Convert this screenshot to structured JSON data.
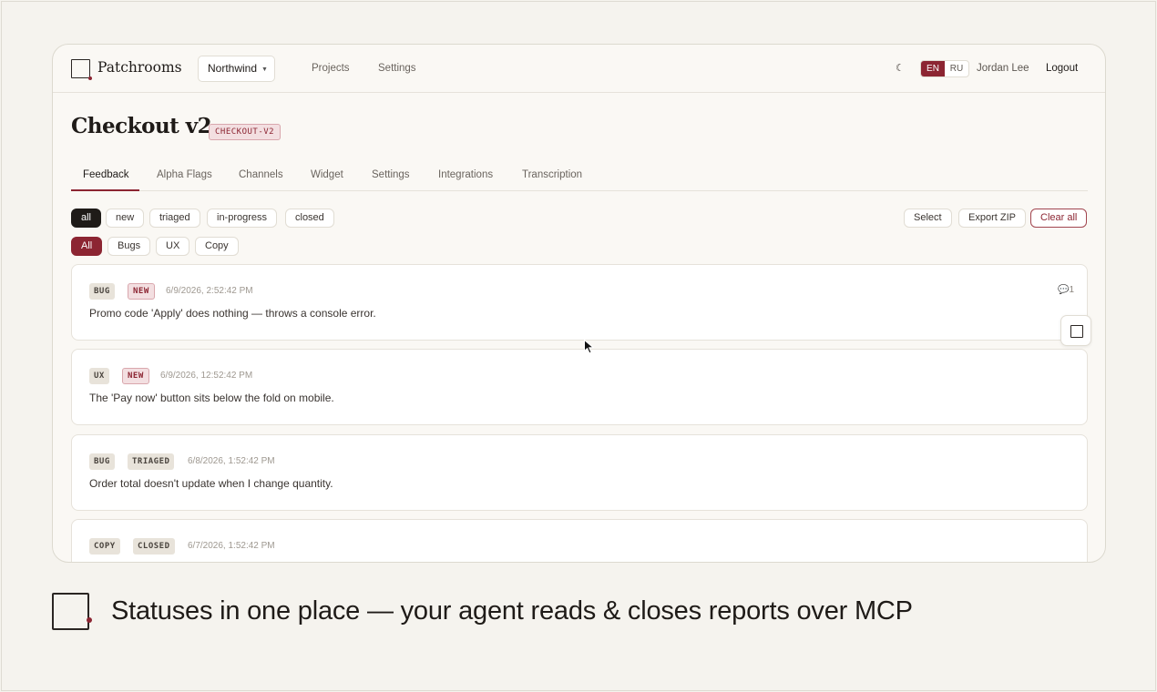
{
  "header": {
    "app_name": "Patchrooms",
    "workspace": "Northwind",
    "nav": [
      "Projects",
      "Settings"
    ],
    "languages": [
      "EN",
      "RU"
    ],
    "active_language": "EN",
    "user": "Jordan Lee",
    "logout_label": "Logout"
  },
  "project": {
    "title": "Checkout v2",
    "slug": "CHECKOUT-V2"
  },
  "tabs": [
    "Feedback",
    "Alpha Flags",
    "Channels",
    "Widget",
    "Settings",
    "Integrations",
    "Transcription"
  ],
  "active_tab": "Feedback",
  "status_filters": [
    "all",
    "new",
    "triaged",
    "in-progress",
    "closed"
  ],
  "active_status_filter": "all",
  "category_filters": [
    "All",
    "Bugs",
    "UX",
    "Copy"
  ],
  "active_category_filter": "All",
  "actions": {
    "select": "Select",
    "export": "Export ZIP",
    "clear": "Clear all"
  },
  "feedback": [
    {
      "category": "BUG",
      "status": "NEW",
      "time": "6/9/2026, 2:52:42 PM",
      "text": "Promo code 'Apply' does nothing — throws a console error.",
      "comments": "1"
    },
    {
      "category": "UX",
      "status": "NEW",
      "time": "6/9/2026, 12:52:42 PM",
      "text": "The 'Pay now' button sits below the fold on mobile."
    },
    {
      "category": "BUG",
      "status": "TRIAGED",
      "time": "6/8/2026, 1:52:42 PM",
      "text": "Order total doesn't update when I change quantity."
    },
    {
      "category": "COPY",
      "status": "CLOSED",
      "time": "6/7/2026, 1:52:42 PM",
      "text": ""
    }
  ],
  "caption": "Statuses in one place — your agent reads & closes reports over MCP",
  "colors": {
    "accent": "#8c2532",
    "background": "#f5f3ee",
    "panel": "#faf8f4"
  }
}
